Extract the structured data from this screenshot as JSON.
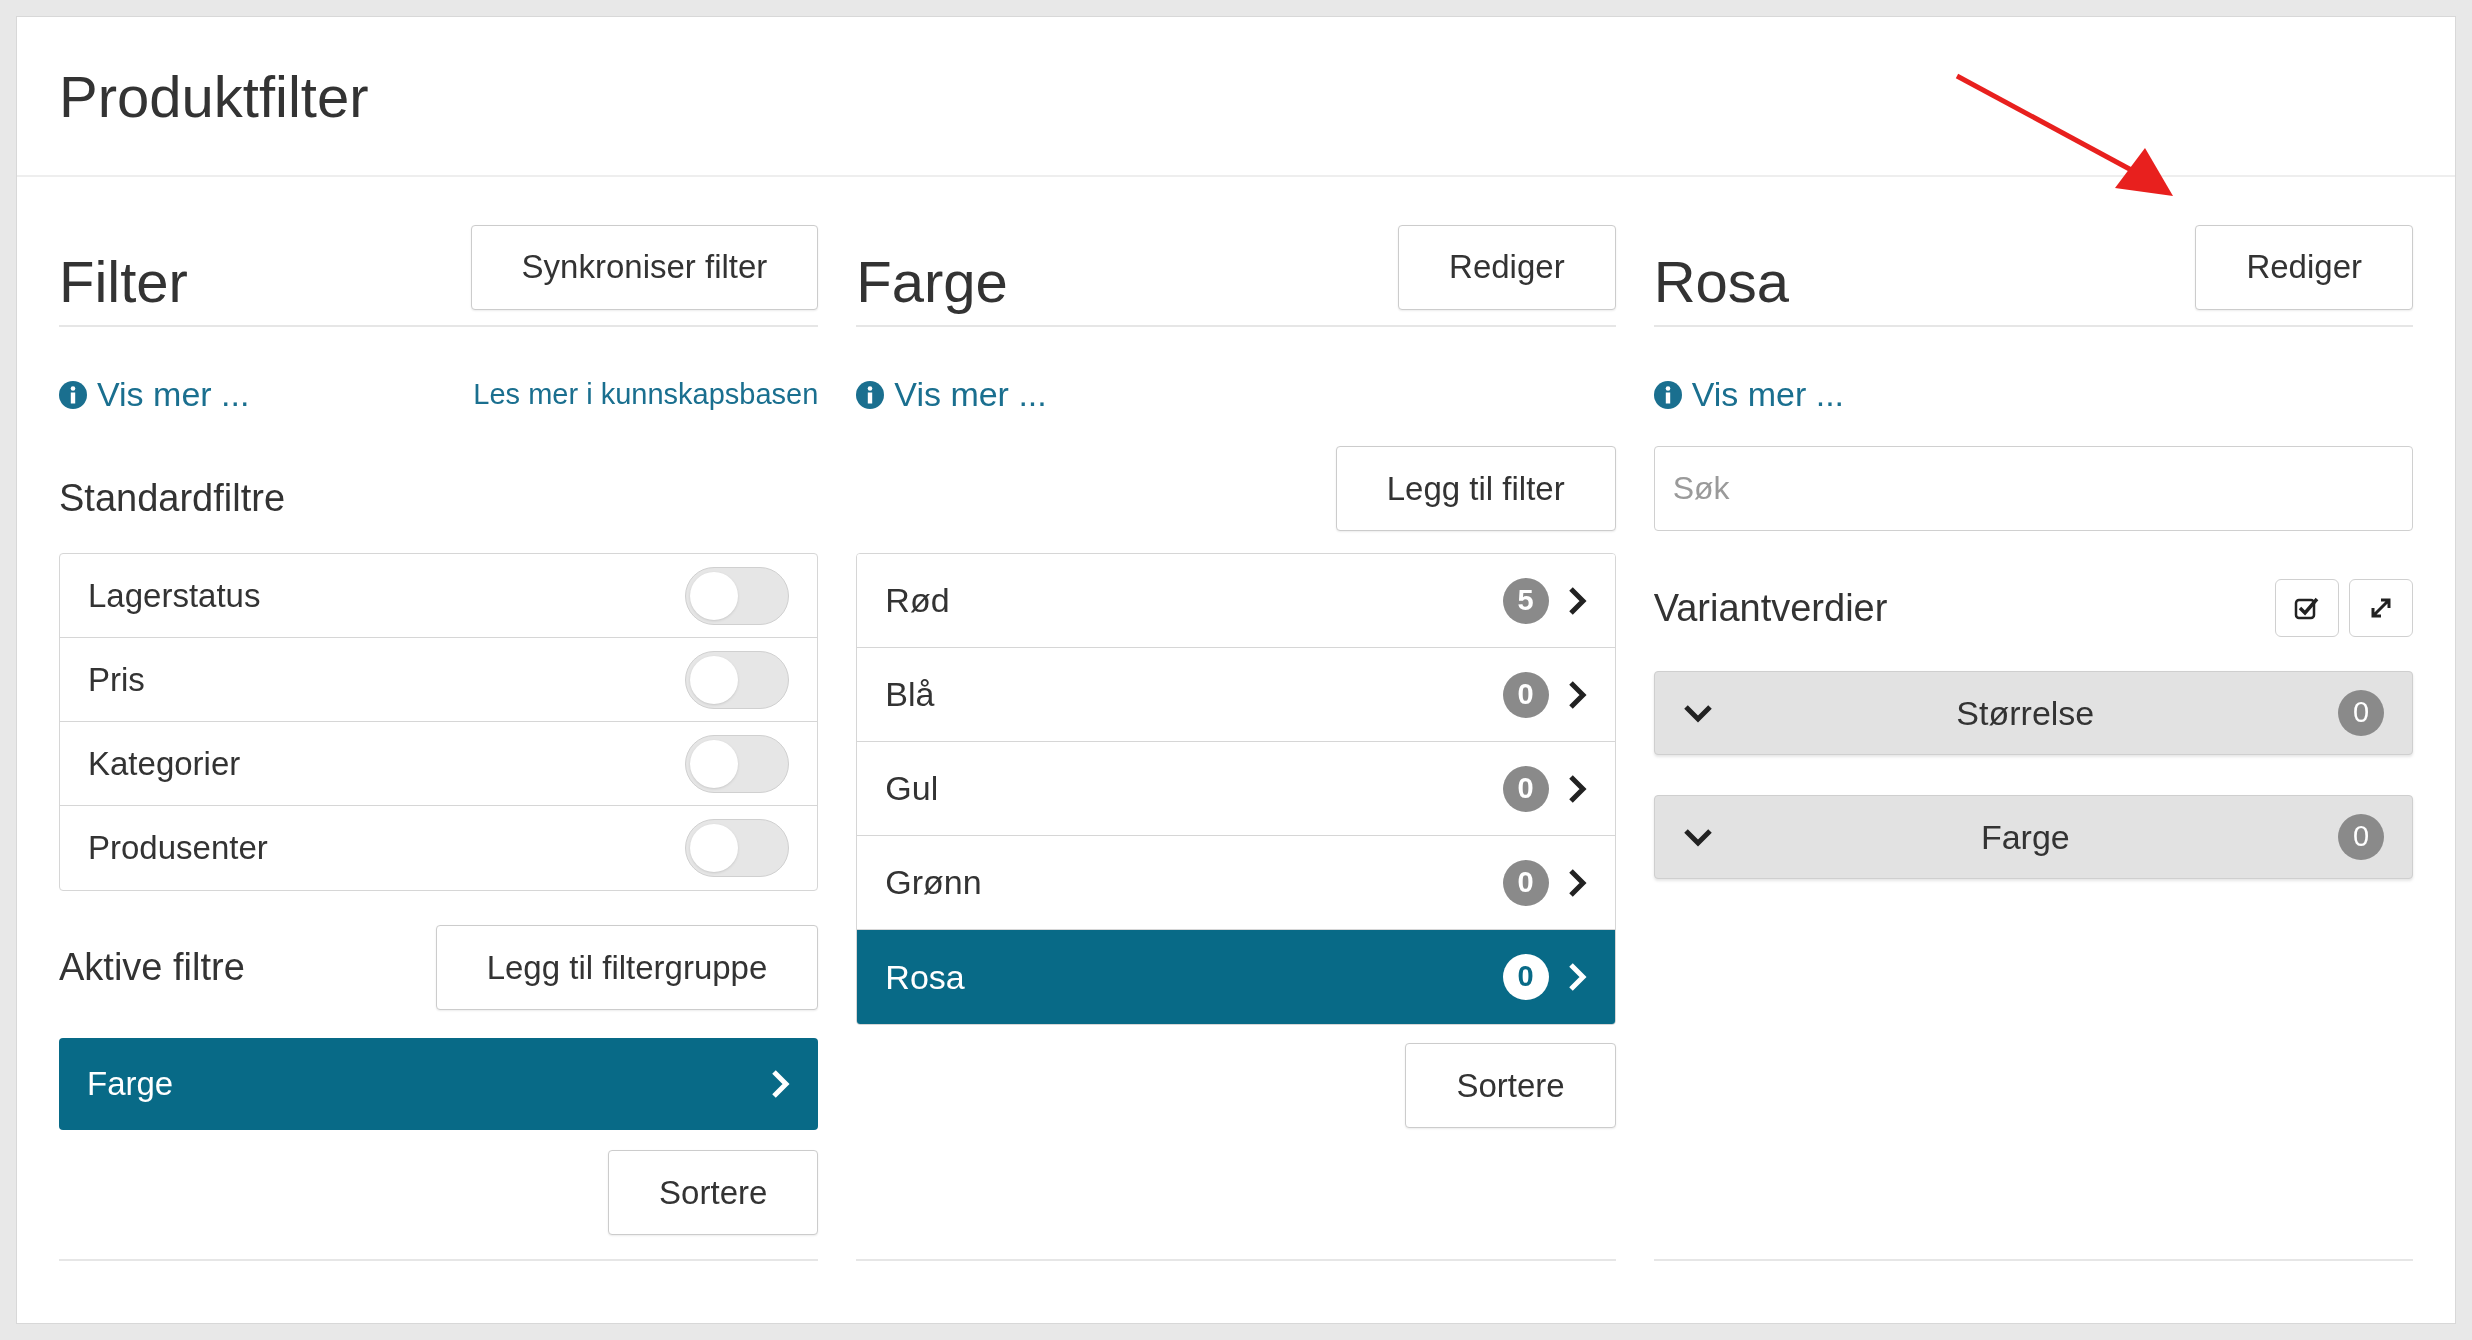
{
  "title": "Produktfilter",
  "filter_panel": {
    "heading": "Filter",
    "button": "Synkroniser filter",
    "info_link": "Vis mer ...",
    "kb_link": "Les mer i kunnskapsbasen",
    "standard_heading": "Standardfiltre",
    "standard_filters": [
      {
        "label": "Lagerstatus",
        "on": false
      },
      {
        "label": "Pris",
        "on": false
      },
      {
        "label": "Kategorier",
        "on": false
      },
      {
        "label": "Produsenter",
        "on": false
      }
    ],
    "active_heading": "Aktive filtre",
    "add_group_button": "Legg til filtergruppe",
    "active_filters": [
      {
        "label": "Farge",
        "selected": true
      }
    ],
    "sort_button": "Sortere"
  },
  "value_panel": {
    "heading": "Farge",
    "button": "Rediger",
    "info_link": "Vis mer ...",
    "add_button": "Legg til filter",
    "values": [
      {
        "label": "Rød",
        "count": "5",
        "selected": false
      },
      {
        "label": "Blå",
        "count": "0",
        "selected": false
      },
      {
        "label": "Gul",
        "count": "0",
        "selected": false
      },
      {
        "label": "Grønn",
        "count": "0",
        "selected": false
      },
      {
        "label": "Rosa",
        "count": "0",
        "selected": true
      }
    ],
    "sort_button": "Sortere"
  },
  "detail_panel": {
    "heading": "Rosa",
    "button": "Rediger",
    "info_link": "Vis mer ...",
    "search": {
      "placeholder": "Søk"
    },
    "variant_heading": "Variantverdier",
    "groups": [
      {
        "label": "Størrelse",
        "count": "0",
        "expanded": false
      },
      {
        "label": "Farge",
        "count": "0",
        "expanded": false
      }
    ]
  }
}
